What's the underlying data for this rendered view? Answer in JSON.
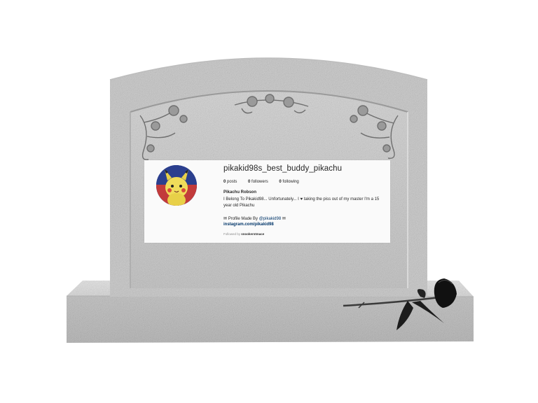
{
  "profile": {
    "username": "pikakid98s_best_buddy_pikachu",
    "posts_count": "0",
    "posts_label": "posts",
    "followers_count": "0",
    "followers_label": "followers",
    "following_count": "0",
    "following_label": "following",
    "full_name": "Pikachu Robson",
    "bio": "I Belong To Pikakid98... Unfortunately... I ♥ taking the piss out of my master I'm a 15 year old Pikachu",
    "made_by_prefix": "✉ Profile Made By ",
    "made_by_handle": "@pikakid98",
    "made_by_suffix": " ✉",
    "website": "instagram.com/pikakid98",
    "followed_by_prefix": "Followed by ",
    "followed_by_user": "snookerstmace"
  },
  "colors": {
    "granite": "#cfcfcf",
    "card_background": "#fafafa",
    "text_primary": "#262626",
    "link": "#003569",
    "muted": "#8e8e8e"
  },
  "icons": {
    "avatar": "pikachu-plush-avatar",
    "decoration": "rose-vine-carving",
    "flower": "black-rose"
  }
}
